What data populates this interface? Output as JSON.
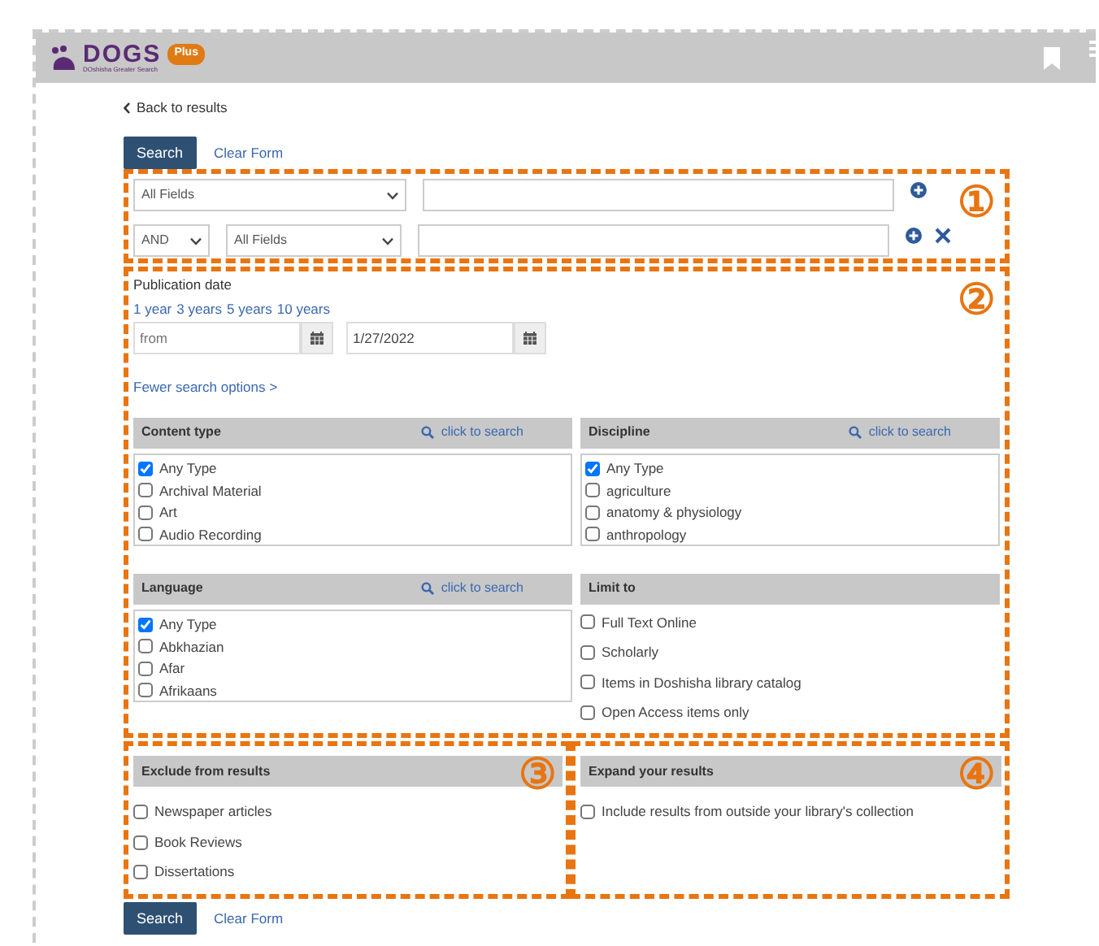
{
  "header": {
    "logo": "DOGS",
    "logo_badge": "Plus",
    "logo_subtitle": "DOshisha Greater Search"
  },
  "back_link": "Back to results",
  "top_actions": {
    "search": "Search",
    "clear": "Clear Form"
  },
  "search_rows": [
    {
      "field": "All Fields",
      "add_button": true,
      "remove_button": false
    },
    {
      "operator": "AND",
      "field": "All Fields",
      "add_button": true,
      "remove_button": true
    }
  ],
  "publication_date": {
    "label": "Publication date",
    "ranges": [
      "1 year",
      "3 years",
      "5 years",
      "10 years"
    ],
    "from_placeholder": "from",
    "to_value": "1/27/2022"
  },
  "fewer_options": "Fewer search options >",
  "facets": [
    {
      "title": "Content type",
      "search_link": "click to search",
      "items": [
        {
          "label": "Any Type",
          "checked": true
        },
        {
          "label": "Archival Material",
          "checked": false
        },
        {
          "label": "Art",
          "checked": false
        },
        {
          "label": "Audio Recording",
          "checked": false
        }
      ]
    },
    {
      "title": "Discipline",
      "search_link": "click to search",
      "items": [
        {
          "label": "Any Type",
          "checked": true
        },
        {
          "label": "agriculture",
          "checked": false
        },
        {
          "label": "anatomy & physiology",
          "checked": false
        },
        {
          "label": "anthropology",
          "checked": false
        }
      ]
    },
    {
      "title": "Language",
      "search_link": "click to search",
      "items": [
        {
          "label": "Any Type",
          "checked": true
        },
        {
          "label": "Abkhazian",
          "checked": false
        },
        {
          "label": "Afar",
          "checked": false
        },
        {
          "label": "Afrikaans",
          "checked": false
        }
      ]
    },
    {
      "title": "Limit to",
      "items": [
        {
          "label": "Full Text Online",
          "checked": false
        },
        {
          "label": "Scholarly",
          "checked": false
        },
        {
          "label": "Items in Doshisha library catalog",
          "checked": false
        },
        {
          "label": "Open Access items only",
          "checked": false
        }
      ]
    }
  ],
  "exclude": {
    "title": "Exclude from results",
    "items": [
      {
        "label": "Newspaper articles",
        "checked": false
      },
      {
        "label": "Book Reviews",
        "checked": false
      },
      {
        "label": "Dissertations",
        "checked": false
      }
    ]
  },
  "expand": {
    "title": "Expand your results",
    "items": [
      {
        "label": "Include results from outside your library's collection",
        "checked": false
      }
    ]
  },
  "bottom_actions": {
    "search": "Search",
    "clear": "Clear Form"
  },
  "callouts": [
    "①",
    "②",
    "③",
    "④"
  ]
}
